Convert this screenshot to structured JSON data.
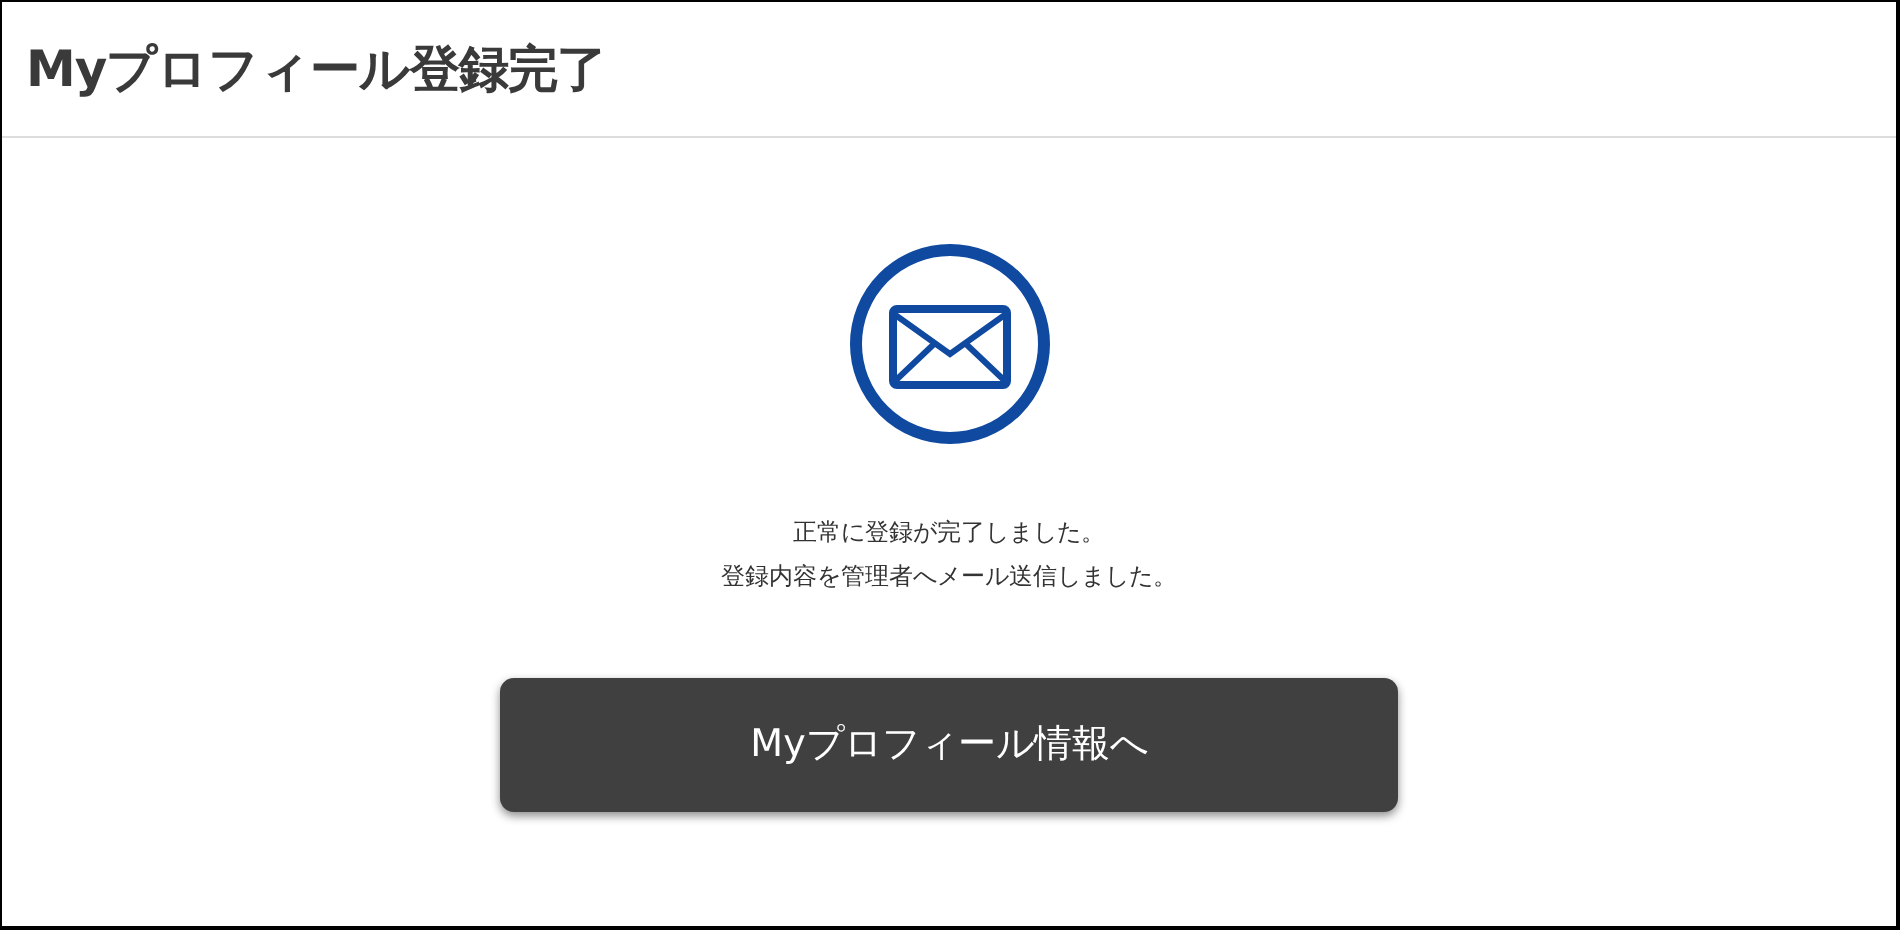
{
  "page": {
    "title": "Myプロフィール登録完了"
  },
  "message": {
    "lines": [
      "正常に登録が完了しました。",
      "登録内容を管理者へメール送信しました。"
    ]
  },
  "button": {
    "label": "Myプロフィール情報へ"
  }
}
